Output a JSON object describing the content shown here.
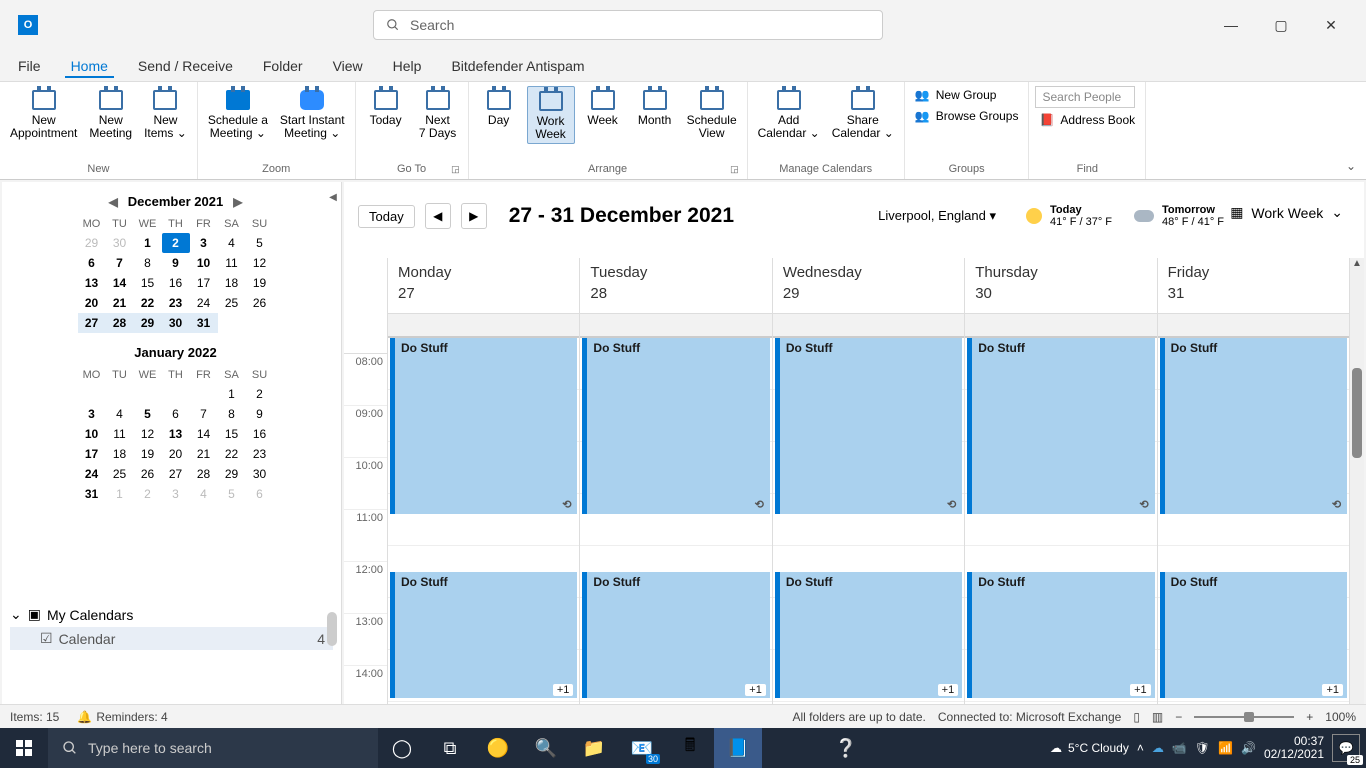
{
  "app": {
    "name": "Outlook"
  },
  "search": {
    "placeholder": "Search"
  },
  "window_controls": {
    "minimize": "—",
    "maximize": "▢",
    "close": "✕"
  },
  "menubar": [
    "File",
    "Home",
    "Send / Receive",
    "Folder",
    "View",
    "Help",
    "Bitdefender Antispam"
  ],
  "menubar_active_index": 1,
  "ribbon": {
    "groups": {
      "new": {
        "label": "New",
        "items": [
          {
            "label": "New\nAppointment"
          },
          {
            "label": "New\nMeeting"
          },
          {
            "label": "New\nItems ⌄"
          }
        ]
      },
      "zoom": {
        "label": "Zoom",
        "items": [
          {
            "label": "Schedule a\nMeeting ⌄"
          },
          {
            "label": "Start Instant\nMeeting ⌄"
          }
        ]
      },
      "goto": {
        "label": "Go To",
        "items": [
          {
            "label": "Today"
          },
          {
            "label": "Next\n7 Days"
          }
        ]
      },
      "arrange": {
        "label": "Arrange",
        "items": [
          {
            "label": "Day"
          },
          {
            "label": "Work\nWeek",
            "selected": true
          },
          {
            "label": "Week"
          },
          {
            "label": "Month"
          },
          {
            "label": "Schedule\nView"
          }
        ]
      },
      "manage": {
        "label": "Manage Calendars",
        "items": [
          {
            "label": "Add\nCalendar ⌄"
          },
          {
            "label": "Share\nCalendar ⌄"
          }
        ]
      },
      "groups_g": {
        "label": "Groups",
        "items": [
          {
            "label": "New Group"
          },
          {
            "label": "Browse Groups"
          }
        ]
      },
      "find": {
        "label": "Find",
        "search_placeholder": "Search People",
        "address_book": "Address Book"
      }
    }
  },
  "mini_cal": {
    "months": [
      {
        "title": "December 2021",
        "dow": [
          "MO",
          "TU",
          "WE",
          "TH",
          "FR",
          "SA",
          "SU"
        ],
        "days": [
          {
            "n": 29,
            "dim": true
          },
          {
            "n": 30,
            "dim": true
          },
          {
            "n": 1,
            "bold": true
          },
          {
            "n": 2,
            "today": true,
            "bold": true
          },
          {
            "n": 3,
            "bold": true
          },
          {
            "n": 4
          },
          {
            "n": 5
          },
          {
            "n": 6,
            "bold": true
          },
          {
            "n": 7,
            "bold": true
          },
          {
            "n": 8
          },
          {
            "n": 9,
            "bold": true
          },
          {
            "n": 10,
            "bold": true
          },
          {
            "n": 11
          },
          {
            "n": 12
          },
          {
            "n": 13,
            "bold": true
          },
          {
            "n": 14,
            "bold": true
          },
          {
            "n": 15
          },
          {
            "n": 16
          },
          {
            "n": 17
          },
          {
            "n": 18
          },
          {
            "n": 19
          },
          {
            "n": 20,
            "bold": true
          },
          {
            "n": 21,
            "bold": true
          },
          {
            "n": 22,
            "bold": true
          },
          {
            "n": 23,
            "bold": true
          },
          {
            "n": 24
          },
          {
            "n": 25
          },
          {
            "n": 26
          },
          {
            "n": 27,
            "bold": true,
            "sel": true
          },
          {
            "n": 28,
            "bold": true,
            "sel": true
          },
          {
            "n": 29,
            "bold": true,
            "sel": true
          },
          {
            "n": 30,
            "bold": true,
            "sel": true
          },
          {
            "n": 31,
            "bold": true,
            "sel": true
          },
          {
            "n": "",
            "dim": true
          },
          {
            "n": "",
            "dim": true
          }
        ]
      },
      {
        "title": "January 2022",
        "dow": [
          "MO",
          "TU",
          "WE",
          "TH",
          "FR",
          "SA",
          "SU"
        ],
        "days": [
          {
            "n": ""
          },
          {
            "n": ""
          },
          {
            "n": ""
          },
          {
            "n": ""
          },
          {
            "n": ""
          },
          {
            "n": 1
          },
          {
            "n": 2
          },
          {
            "n": 3,
            "bold": true
          },
          {
            "n": 4
          },
          {
            "n": 5,
            "bold": true
          },
          {
            "n": 6
          },
          {
            "n": 7
          },
          {
            "n": 8
          },
          {
            "n": 9
          },
          {
            "n": 10,
            "bold": true
          },
          {
            "n": 11
          },
          {
            "n": 12
          },
          {
            "n": 13,
            "bold": true
          },
          {
            "n": 14
          },
          {
            "n": 15
          },
          {
            "n": 16
          },
          {
            "n": 17,
            "bold": true
          },
          {
            "n": 18
          },
          {
            "n": 19
          },
          {
            "n": 20
          },
          {
            "n": 21
          },
          {
            "n": 22
          },
          {
            "n": 23
          },
          {
            "n": 24,
            "bold": true
          },
          {
            "n": 25
          },
          {
            "n": 26
          },
          {
            "n": 27
          },
          {
            "n": 28
          },
          {
            "n": 29
          },
          {
            "n": 30
          },
          {
            "n": 31,
            "bold": true
          },
          {
            "n": 1,
            "dim": true
          },
          {
            "n": 2,
            "dim": true
          },
          {
            "n": 3,
            "dim": true
          },
          {
            "n": 4,
            "dim": true
          },
          {
            "n": 5,
            "dim": true
          },
          {
            "n": 6,
            "dim": true
          }
        ]
      }
    ]
  },
  "my_calendars": {
    "header": "My Calendars",
    "items": [
      {
        "name": "Calendar",
        "count": 4
      }
    ]
  },
  "main_header": {
    "today_btn": "Today",
    "date_range": "27 - 31 December 2021",
    "location": "Liverpool, England",
    "weather": [
      {
        "label": "Today",
        "temp": "41° F / 37° F"
      },
      {
        "label": "Tomorrow",
        "temp": "48° F / 41° F"
      }
    ],
    "view": "Work Week"
  },
  "cal": {
    "days": [
      {
        "name": "Monday",
        "num": 27
      },
      {
        "name": "Tuesday",
        "num": 28
      },
      {
        "name": "Wednesday",
        "num": 29
      },
      {
        "name": "Thursday",
        "num": 30
      },
      {
        "name": "Friday",
        "num": 31
      }
    ],
    "time_labels": [
      "08:00",
      "09:00",
      "10:00",
      "11:00",
      "12:00",
      "13:00",
      "14:00"
    ],
    "events": {
      "morning": {
        "title": "Do Stuff",
        "start": "08:00",
        "end": "11:30"
      },
      "afternoon": {
        "title": "Do Stuff",
        "start": "12:30",
        "more": "+1"
      }
    }
  },
  "status": {
    "items": "Items: 15",
    "reminders": "Reminders: 4",
    "folders": "All folders are up to date.",
    "connected": "Connected to: Microsoft Exchange",
    "zoom": "100%"
  },
  "taskbar": {
    "search_placeholder": "Type here to search",
    "weather": "5°C  Cloudy",
    "time": "00:37",
    "date": "02/12/2021",
    "mail_badge": "30",
    "notif_badge": "25"
  }
}
